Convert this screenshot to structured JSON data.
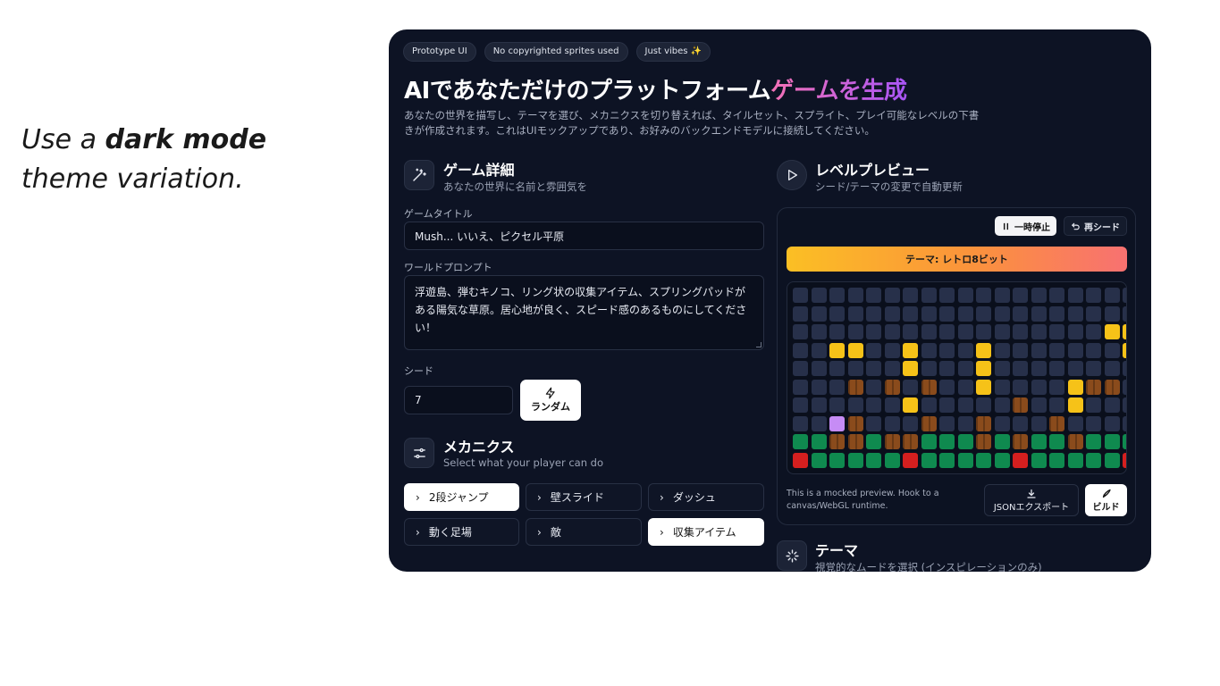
{
  "caption": {
    "line1_prefix": "Use a ",
    "line1_bold": "dark mode",
    "line2": "theme variation."
  },
  "pills": [
    "Prototype UI",
    "No copyrighted sprites used",
    "Just vibes ✨"
  ],
  "headline": {
    "main": "AIであなただけのプラットフォーム",
    "accent": "ゲームを生成"
  },
  "description": "あなたの世界を描写し、テーマを選び、メカニクスを切り替えれば、タイルセット、スプライト、プレイ可能なレベルの下書きが作成されます。これはUIモックアップであり、お好みのバックエンドモデルに接続してください。",
  "game_details": {
    "title": "ゲーム詳細",
    "subtitle": "あなたの世界に名前と雰囲気を",
    "title_label": "ゲームタイトル",
    "title_value": "Mush... いいえ、ピクセル平原",
    "prompt_label": "ワールドプロンプト",
    "prompt_value": "浮遊島、弾むキノコ、リング状の収集アイテム、スプリングパッドがある陽気な草原。居心地が良く、スピード感のあるものにしてください！",
    "seed_label": "シード",
    "seed_value": "7",
    "random_label": "ランダム"
  },
  "mechanics": {
    "title": "メカニクス",
    "subtitle": "Select what your player can do",
    "items": [
      {
        "label": "2段ジャンプ",
        "selected": true
      },
      {
        "label": "壁スライド",
        "selected": false
      },
      {
        "label": "ダッシュ",
        "selected": false
      },
      {
        "label": "動く足場",
        "selected": false
      },
      {
        "label": "敵",
        "selected": false
      },
      {
        "label": "収集アイテム",
        "selected": true
      }
    ]
  },
  "level_preview": {
    "title": "レベルプレビュー",
    "subtitle": "シード/テーマの変更で自動更新",
    "pause_label": "一時停止",
    "reseed_label": "再シード",
    "theme_label": "テーマ: レトロ8ビット",
    "note": "This is a mocked preview. Hook to a canvas/WebGL runtime.",
    "export_label": "JSONエクスポート",
    "build_label": "ビルド",
    "tile_colors": {
      "empty": "#27304a",
      "coin": "#f6c218",
      "brick": "#8a4b1c",
      "grass": "#0f8a4f",
      "lava": "#d51f1f",
      "player": "#c68cf5"
    },
    "rows": [
      "..................",
      "..................",
      ".................CC",
      "..CC..C...C.......C",
      "......C...C.......",
      "...B.B.B..C....CBB.",
      "......C.....B..C...",
      "..PB...B..B...B....",
      "GGBBGBBGGGBGBGGBGGG",
      "LGGGGGLGGGGGLGGGGGL"
    ]
  },
  "themes_section": {
    "title": "テーマ",
    "subtitle": "視覚的なムードを選択 (インスピレーションのみ)"
  }
}
